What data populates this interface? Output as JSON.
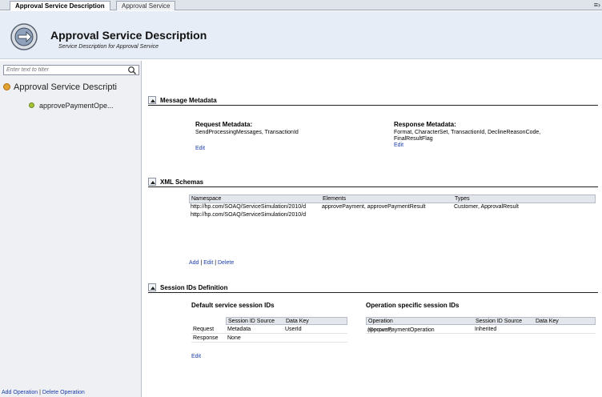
{
  "tabs": [
    {
      "label": "Approval Service Description",
      "active": true
    },
    {
      "label": "Approval Service",
      "active": false
    }
  ],
  "tab_menu_icon": "chevron-menu-icon",
  "header": {
    "title": "Approval Service Description",
    "subtitle": "Service Description for Approval Service"
  },
  "sidebar": {
    "filter_placeholder": "Enter text to filter",
    "root_label": "Approval Service Descripti",
    "child_label": "approvePaymentOpe...",
    "add_operation": "Add Operation",
    "separator": "|",
    "delete_operation": "Delete Operation"
  },
  "message_metadata": {
    "title": "Message Metadata",
    "request_heading": "Request Metadata:",
    "request_value": "SendProcessingMessages, TransactionId",
    "request_edit": "Edit",
    "response_heading": "Response Metadata:",
    "response_value_line1": "Format, CharacterSet, TransactionId, DeclineReasonCode,",
    "response_value_line2": "FinalResultFlag",
    "response_edit": "Edit"
  },
  "xml_schemas": {
    "title": "XML Schemas",
    "columns": {
      "namespace": "Namespace",
      "elements": "Elements",
      "types": "Types"
    },
    "rows": [
      {
        "namespace": "http://hp.com/SOAQ/ServiceSimulation/2010/d",
        "elements": "approvePayment, approvePaymentResult",
        "types": "Customer, ApprovalResult"
      },
      {
        "namespace": "http://hp.com/SOAQ/ServiceSimulation/2010/d",
        "elements": "",
        "types": ""
      }
    ],
    "add": "Add",
    "edit": "Edit",
    "delete": "Delete",
    "sep": "|"
  },
  "session_ids": {
    "title": "Session IDs Definition",
    "default_heading": "Default service session IDs",
    "default_columns": {
      "source": "Session ID Source",
      "key": "Data Key"
    },
    "default_rows": [
      {
        "label": "Request",
        "source": "Metadata",
        "key": "UserId"
      },
      {
        "label": "Response",
        "source": "None",
        "key": ""
      }
    ],
    "default_edit": "Edit",
    "operation_heading": "Operation specific session IDs",
    "operation_columns": {
      "operation": "Operation",
      "source": "Session ID Source",
      "key": "Data Key"
    },
    "operation_rows": [
      {
        "operation": "approvePaymentOperation",
        "qualifier": "(Request)",
        "source": "Inherited",
        "key": ""
      }
    ]
  }
}
